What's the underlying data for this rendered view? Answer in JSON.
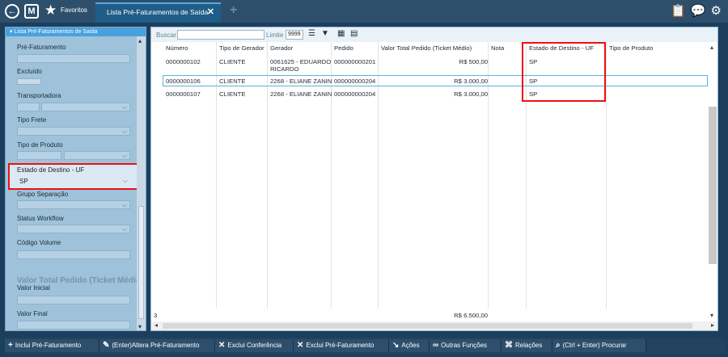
{
  "topbar": {
    "favorites_label": "Favoritos",
    "tab_label": "Lista Pré-Faturamentos de Saída",
    "tab_close": "✕",
    "add_tab": "+",
    "icons": [
      "back-circle-icon",
      "m-logo-icon",
      "star-icon",
      "clipboard-icon",
      "chat-icon",
      "gear-icon"
    ]
  },
  "filters": {
    "panel_title": "Lista Pré-Faturamentos de Saída",
    "pre_faturamento": "Pré-Faturamento",
    "excluido": "Excluído",
    "transportadora": "Transportadora",
    "tipo_frete": "Tipo Frete",
    "tipo_produto": "Tipo de Produto",
    "estado_destino": "Estado de Destino - UF",
    "estado_destino_value": "SP",
    "grupo_separacao": "Grupo Separação",
    "status_workflow": "Status Workflow",
    "codigo_volume": "Código Volume",
    "section_valor": "Valor Total Pedido (Ticket Médio)",
    "valor_inicial": "Valor Inicial",
    "valor_final": "Valor Final"
  },
  "toolbar": {
    "buscar": "Buscar",
    "limite": "Limite",
    "limite_value": "9999"
  },
  "grid": {
    "columns": [
      "Número",
      "Tipo de Gerador",
      "Gerador",
      "Pedido",
      "Valor Total Pedido (Ticket Médio)",
      "Nota",
      "Estado de Destino - UF",
      "Tipo de Produto"
    ],
    "rows": [
      {
        "numero": "0000000102",
        "tipo": "CLIENTE",
        "gerador": "0061625 - EDUARDO",
        "gerador2": "RICARDO",
        "pedido": "000000000201",
        "valor": "R$ 500,00",
        "nota": "",
        "uf": "SP",
        "tipo_prod": ""
      },
      {
        "numero": "0000000106",
        "tipo": "CLIENTE",
        "gerador": "2268 - ELIANE ZANIN",
        "gerador2": "",
        "pedido": "000000000204",
        "valor": "R$ 3.000,00",
        "nota": "",
        "uf": "SP",
        "tipo_prod": ""
      },
      {
        "numero": "0000000107",
        "tipo": "CLIENTE",
        "gerador": "2268 - ELIANE ZANIN",
        "gerador2": "",
        "pedido": "000000000204",
        "valor": "R$ 3.000,00",
        "nota": "",
        "uf": "SP",
        "tipo_prod": ""
      }
    ],
    "footer_count": "3",
    "footer_total": "R$ 6.500,00"
  },
  "actions": {
    "incluir": "Inclui Pré-Faturamento",
    "alterar": "(Enter)Altera Pré-Faturamento",
    "exclui_conf": "Exclui Conferência",
    "exclui_pre": "Exclui Pré-Faturamento",
    "acoes": "Ações",
    "outras": "Outras Funções",
    "relacoes": "Relações",
    "procurar": "(Ctrl + Enter) Procurar"
  },
  "colors": {
    "accent": "#4aa0dd",
    "highlight": "#ee1111",
    "topbar": "#2d4f6c"
  }
}
